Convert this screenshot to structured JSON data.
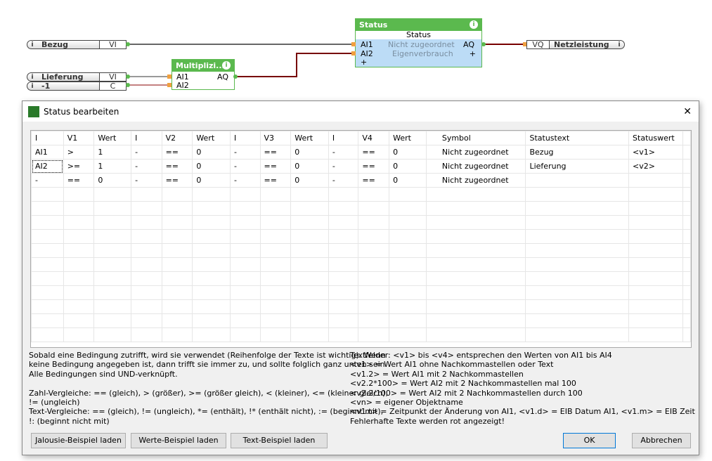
{
  "diagram": {
    "inputs": [
      {
        "name": "Bezug",
        "type": "VI"
      },
      {
        "name": "Lieferung",
        "type": "VI"
      },
      {
        "name": "-1",
        "type": "C"
      }
    ],
    "info_glyph": "i",
    "mult": {
      "title": "Multiplizi...",
      "in1": "AI1",
      "in2": "AI2",
      "out": "AQ"
    },
    "status": {
      "title": "Status",
      "subtitle": "Status",
      "in1": "AI1",
      "in2": "AI2",
      "lbl1": "Nicht zugeordnet",
      "lbl2": "Eigenverbrauch",
      "out": "AQ",
      "plus": "+"
    },
    "output": {
      "type": "VQ",
      "name": "Netzleistung"
    }
  },
  "dialog": {
    "title": "Status bearbeiten",
    "close": "✕",
    "columns": [
      "I",
      "V1",
      "Wert",
      "I",
      "V2",
      "Wert",
      "I",
      "V3",
      "Wert",
      "I",
      "V4",
      "Wert",
      "Symbol",
      "Statustext",
      "Statuswert"
    ],
    "rows": [
      [
        "AI1",
        ">",
        "1",
        "-",
        "==",
        "0",
        "-",
        "==",
        "0",
        "-",
        "==",
        "0",
        "Nicht zugeordnet",
        "Bezug",
        "<v1>"
      ],
      [
        "AI2",
        ">=",
        "1",
        "-",
        "==",
        "0",
        "-",
        "==",
        "0",
        "-",
        "==",
        "0",
        "Nicht zugeordnet",
        "Lieferung",
        "<v2>"
      ],
      [
        "-",
        "==",
        "0",
        "-",
        "==",
        "0",
        "-",
        "==",
        "0",
        "-",
        "==",
        "0",
        "Nicht zugeordnet",
        "",
        ""
      ]
    ],
    "help_left": "Sobald eine Bedingung zutrifft, wird sie verwendet (Reihenfolge der Texte ist wichtig). Wenn\nkeine Bedingung angegeben ist, dann trifft sie immer zu, und sollte folglich ganz unten sein.\nAlle Bedingungen sind UND-verknüpft.\n\nZahl-Vergleiche: == (gleich), > (größer), >= (größer gleich), < (kleiner), <= (kleiner gleich),\n!= (ungleich)\nText-Vergleiche: == (gleich), != (ungleich), *= (enthält), !* (enthält nicht), := (beginnt mit),\n!: (beginnt nicht mit)",
    "help_right": "Textfelder: <v1> bis <v4> entsprechen den Werten von AI1 bis AI4\n<v1> = Wert AI1 ohne Nachkommastellen oder Text\n<v1.2> = Wert AI1 mit 2 Nachkommastellen\n<v2.2*100> = Wert AI2 mit 2 Nachkommastellen mal 100\n<v2.2/100> = Wert AI2 mit 2 Nachkommastellen durch 100\n<vn> = eigener Objektname\n<v1.t> = Zeitpunkt der Änderung von AI1, <v1.d> = EIB Datum AI1, <v1.m> = EIB Zeit\nFehlerhafte Texte werden rot angezeigt!",
    "buttons": {
      "jalousie": "Jalousie-Beispiel laden",
      "werte": "Werte-Beispiel laden",
      "text": "Text-Beispiel laden",
      "ok": "OK",
      "cancel": "Abbrechen"
    }
  }
}
